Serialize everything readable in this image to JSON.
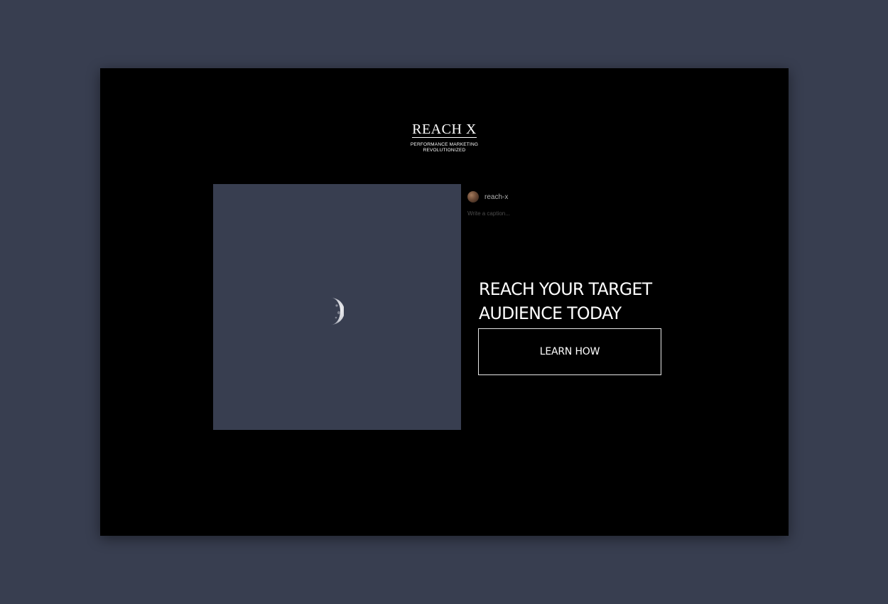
{
  "brand": {
    "name": "REACH X",
    "tagline_line1": "PERFORMANCE MARKETING",
    "tagline_line2": "REVOLUTIONIZED"
  },
  "post": {
    "image_icon": "moon-icon",
    "username": "reach-x",
    "caption_placeholder": "Write a caption..."
  },
  "cta": {
    "heading_line1": "REACH YOUR TARGET",
    "heading_line2": "AUDIENCE TODAY",
    "button_label": "LEARN HOW"
  },
  "colors": {
    "page_background": "#383e50",
    "frame_background": "#000000",
    "image_background": "#383e50",
    "text": "#ffffff"
  }
}
